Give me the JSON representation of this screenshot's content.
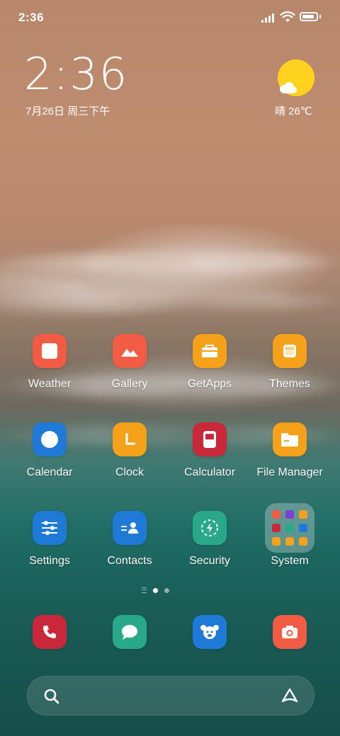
{
  "status_bar": {
    "time": "2:36",
    "signal_icon": "signal-icon",
    "wifi_icon": "wifi-icon",
    "battery_icon": "battery-icon",
    "battery_level": 0.9
  },
  "clock_widget": {
    "time": "2:36",
    "date": "7月26日 周三下午"
  },
  "weather_widget": {
    "text": "晴 26℃",
    "icon": "sun-cloud-icon"
  },
  "apps": [
    {
      "label": "Weather",
      "icon": "weather-icon",
      "color": "#f25c45"
    },
    {
      "label": "Gallery",
      "icon": "gallery-icon",
      "color": "#f25c45"
    },
    {
      "label": "GetApps",
      "icon": "getapps-icon",
      "color": "#f6a11a"
    },
    {
      "label": "Themes",
      "icon": "themes-icon",
      "color": "#f6a11a"
    },
    {
      "label": "Calendar",
      "icon": "calendar-icon",
      "color": "#1e7ad6"
    },
    {
      "label": "Clock",
      "icon": "clock-icon",
      "color": "#f6a11a"
    },
    {
      "label": "Calculator",
      "icon": "calculator-icon",
      "color": "#c8283a"
    },
    {
      "label": "File Manager",
      "icon": "folder-icon",
      "color": "#f6a11a"
    },
    {
      "label": "Settings",
      "icon": "settings-icon",
      "color": "#1e7ad6"
    },
    {
      "label": "Contacts",
      "icon": "contacts-icon",
      "color": "#1e7ad6"
    },
    {
      "label": "Security",
      "icon": "security-icon",
      "color": "#2aa88a"
    },
    {
      "label": "System",
      "icon": "folder-system-icon",
      "color": "#ffffff"
    }
  ],
  "page_indicator": {
    "pages": 2,
    "current": 1
  },
  "dock": [
    {
      "icon": "phone-icon",
      "color": "#c8283a"
    },
    {
      "icon": "messaging-icon",
      "color": "#2aa88a"
    },
    {
      "icon": "browser-icon",
      "color": "#1e7ad6"
    },
    {
      "icon": "camera-icon",
      "color": "#f25c45"
    }
  ],
  "search_bar": {
    "search_icon": "search-icon",
    "assistant_icon": "assistant-icon"
  }
}
